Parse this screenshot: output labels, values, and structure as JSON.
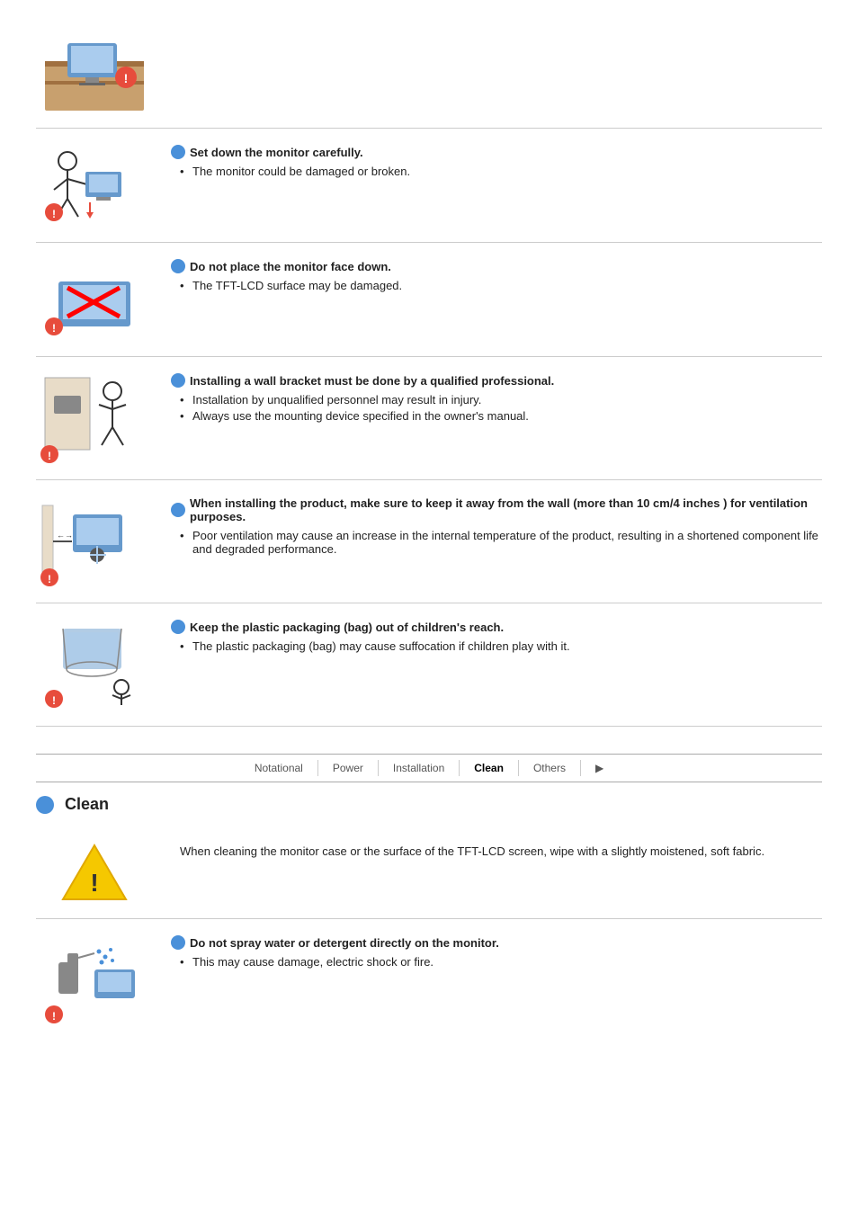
{
  "sections": [
    {
      "id": "section-monitor-down",
      "title": "Set down the monitor carefully.",
      "bullets": [
        "The monitor could be damaged or broken."
      ],
      "illus": "monitor-careful"
    },
    {
      "id": "section-face-down",
      "title": "Do not place the monitor face down.",
      "bullets": [
        "The TFT-LCD surface may be damaged."
      ],
      "illus": "monitor-face-down"
    },
    {
      "id": "section-wall-bracket",
      "title": "Installing a wall bracket must be done by a qualified professional.",
      "bullets": [
        "Installation by unqualified personnel may result in injury.",
        "Always use the mounting device specified in the owner's manual."
      ],
      "illus": "wall-bracket"
    },
    {
      "id": "section-ventilation",
      "title": "When installing the product, make sure to keep it away from the wall (more than 10 cm/4 inches ) for ventilation purposes.",
      "bullets": [
        "Poor ventilation may cause an increase in the internal temperature of the product, resulting in a shortened component life and degraded performance."
      ],
      "illus": "ventilation"
    },
    {
      "id": "section-packaging",
      "title": "Keep the plastic packaging (bag) out of children's reach.",
      "bullets": [
        "The plastic packaging (bag) may cause suffocation if children play with it."
      ],
      "illus": "packaging-child"
    }
  ],
  "nav": {
    "items": [
      "Notational",
      "Power",
      "Installation",
      "Clean",
      "Others"
    ],
    "active": "Clean"
  },
  "clean_section": {
    "heading": "Clean",
    "warn_text": "When cleaning the monitor case or the surface of the TFT-LCD screen, wipe with a slightly moistened, soft fabric.",
    "sub_sections": [
      {
        "id": "no-spray",
        "title": "Do not spray water or detergent directly on the monitor.",
        "bullets": [
          "This may cause damage, electric shock or fire."
        ],
        "illus": "spray-warning"
      }
    ]
  }
}
